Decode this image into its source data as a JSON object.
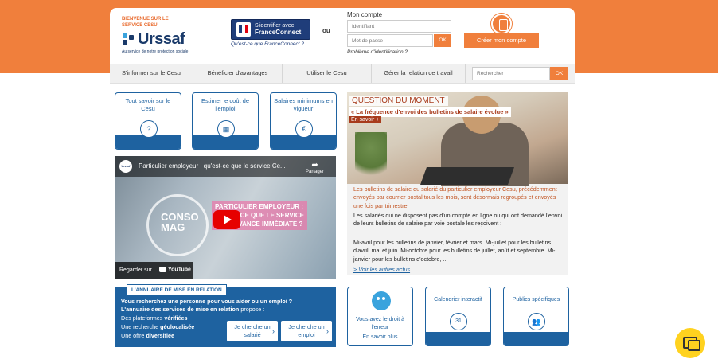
{
  "header": {
    "welcome": "BIENVENUE SUR LE SERVICE CESU",
    "logo_text": "Urssaf",
    "logo_tagline": "Au service de notre protection sociale",
    "fc_line1": "S'identifier avec",
    "fc_line2": "FranceConnect",
    "fc_link": "Qu'est-ce que FranceConnect ?",
    "or_text": "ou",
    "account_title": "Mon compte",
    "id_placeholder": "Identifiant",
    "pw_placeholder": "Mot de passe",
    "ok_label": "OK",
    "problem_link": "Problème d'identification ?",
    "create_account": "Créer mon compte"
  },
  "nav": {
    "items": [
      {
        "label": "S'informer sur le Cesu"
      },
      {
        "label": "Bénéficier d'avantages"
      },
      {
        "label": "Utiliser le Cesu"
      },
      {
        "label": "Gérer la relation de travail"
      }
    ],
    "search_placeholder": "Rechercher",
    "ok_label": "OK"
  },
  "tiles": [
    {
      "label": "Tout savoir sur le Cesu",
      "icon": "question-icon"
    },
    {
      "label": "Estimer le coût de l'emploi",
      "icon": "calculator-icon"
    },
    {
      "label": "Salaires minimums en vigueur",
      "icon": "euro-icon"
    }
  ],
  "video": {
    "channel": "Urssaf",
    "title": "Particulier employeur : qu'est-ce que le service Ce...",
    "share": "Partager",
    "logo_line1": "CONSO",
    "logo_line2": "MAG",
    "banner": "PARTICULIER EMPLOYEUR : QU'EST-CE QUE LE SERVICE CESU AVANCE IMMÉDIATE ?",
    "watch_on": "Regarder sur",
    "yt": "YouTube"
  },
  "annuaire": {
    "tag": "L'ANNUAIRE DE MISE EN RELATION",
    "question": "Vous recherchez une personne pour vous aider ou un emploi ?",
    "line1_bold": "L'annuaire des services de mise en relation",
    "line1_rest": " propose :",
    "line2_a": "Des plateformes ",
    "line2_b": "vérifiées",
    "line3_a": "Une recherche ",
    "line3_b": "géolocalisée",
    "line4_a": "Une offre ",
    "line4_b": "diversifiée",
    "btn1": "Je cherche un salarié",
    "btn2": "Je cherche un emploi"
  },
  "news": {
    "tag": "QUESTION DU MOMENT",
    "headline": "« La fréquence d'envoi des bulletins de salaire évolue »",
    "more": "En savoir +",
    "para1": "Les bulletins de salaire du salarié du particulier employeur Cesu, précédemment envoyés par courrier postal tous les mois, sont désormais regroupés et envoyés une fois par trimestre.",
    "para2": "Les salariés qui ne disposent pas d'un compte en ligne ou qui ont demandé l'envoi de leurs bulletins de salaire par voie postale les reçoivent :",
    "para3": "Mi-avril pour les bulletins de janvier, février et mars. Mi-juillet pour les bulletins d'avril, mai et juin. Mi-octobre pour les bulletins de juillet, août et septembre. Mi-janvier pour les bulletins d'octobre, ...",
    "link": "> Voir les autres actus"
  },
  "tiles2": [
    {
      "line1": "Vous avez le droit à l'erreur",
      "line2": "En savoir plus"
    },
    {
      "label": "Calendrier interactif",
      "icon": "calendar-icon",
      "day": "31"
    },
    {
      "label": "Publics spécifiques",
      "icon": "people-icon"
    }
  ],
  "colors": {
    "brand_orange": "#f07f3c",
    "brand_blue": "#1e62a0",
    "news_red": "#a83b1c"
  }
}
